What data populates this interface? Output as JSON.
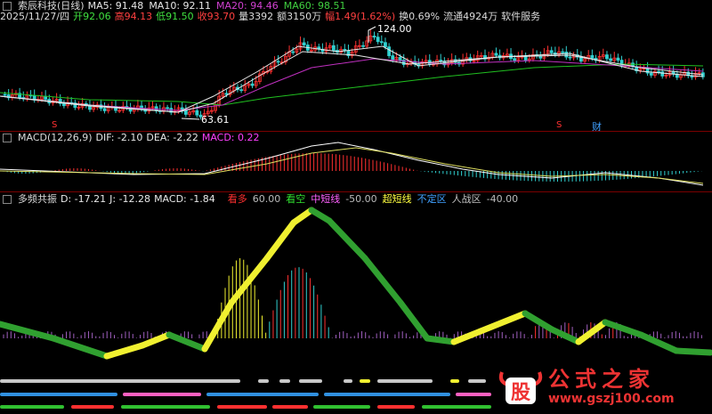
{
  "price_panel": {
    "stock_title": "索辰科技(日线)",
    "ma": [
      {
        "label": "MA5: 91.48",
        "color": "#e8e8e8"
      },
      {
        "label": "MA10: 92.11",
        "color": "#e8e8e8"
      },
      {
        "label": "MA20: 94.46",
        "color": "#d040d0"
      },
      {
        "label": "MA60: 98.51",
        "color": "#40d040"
      }
    ],
    "info": [
      {
        "label": "2025/11/27/四",
        "color": "#dcdcdc"
      },
      {
        "label": "开92.06",
        "color": "#40e040"
      },
      {
        "label": "高94.13",
        "color": "#ff4040"
      },
      {
        "label": "低91.50",
        "color": "#40e040"
      },
      {
        "label": "收93.70",
        "color": "#ff4040"
      },
      {
        "label": "量3392",
        "color": "#dcdcdc"
      },
      {
        "label": "额3150万",
        "color": "#dcdcdc"
      },
      {
        "label": "幅1.49(1.62%)",
        "color": "#ff4040"
      },
      {
        "label": "换0.69%",
        "color": "#dcdcdc"
      },
      {
        "label": "流通4924万",
        "color": "#dcdcdc"
      },
      {
        "label": "软件服务",
        "color": "#dcdcdc"
      }
    ],
    "high_marker": "124.00",
    "low_marker": "63.61",
    "event_markers": [
      "S",
      "S",
      "财"
    ]
  },
  "macd_panel": {
    "title": "MACD(12,26,9)",
    "dif": "DIF: -2.10",
    "dea": "DEA: -2.22",
    "macd": "MACD: 0.22"
  },
  "resonance_panel": {
    "title": "多频共振",
    "d": "D: -17.21",
    "j": "J: -12.28",
    "macd": "MACD: -1.84",
    "legend": [
      {
        "label": "看多",
        "value": "60.00",
        "color": "#ff3030"
      },
      {
        "label": "看空",
        "value": "",
        "color": "#30e030"
      },
      {
        "label": "中短线",
        "value": "-50.00",
        "color": "#ff60ff"
      },
      {
        "label": "超短线",
        "value": "",
        "color": "#ffff40"
      },
      {
        "label": "不定区",
        "value": "",
        "color": "#40a0ff"
      },
      {
        "label": "人战区",
        "value": "-40.00",
        "color": "#c0c0c0"
      }
    ]
  },
  "watermark": {
    "logo_char": "股",
    "site_name": "公式之家",
    "url": "www.gszj100.com"
  },
  "colors": {
    "up": "#ff3030",
    "down": "#30d0d0",
    "ma60": "#20c020",
    "ma20": "#c030c0",
    "ribbon_yellow": "#f0f030",
    "ribbon_green": "#30a030"
  }
}
